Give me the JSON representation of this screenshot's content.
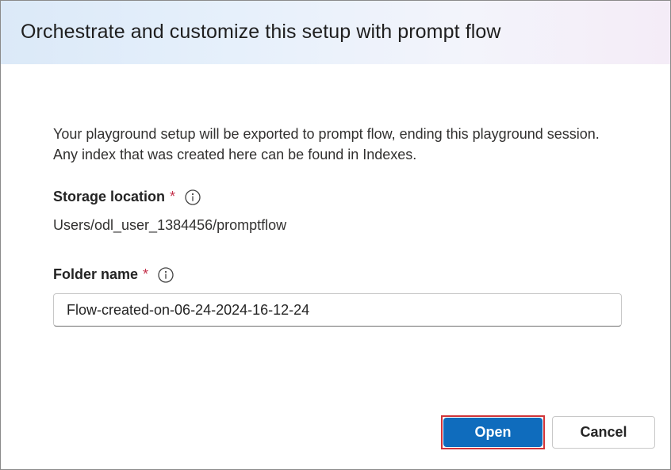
{
  "dialog": {
    "title": "Orchestrate and customize this setup with prompt flow",
    "description": "Your playground setup will be exported to prompt flow, ending this playground session. Any index that was created here can be found in Indexes.",
    "storage": {
      "label": "Storage location",
      "required_mark": "*",
      "info_icon": "info-circle-icon",
      "value": "Users/odl_user_1384456/promptflow"
    },
    "folder": {
      "label": "Folder name",
      "required_mark": "*",
      "info_icon": "info-circle-icon",
      "value": "Flow-created-on-06-24-2024-16-12-24"
    },
    "buttons": {
      "open_label": "Open",
      "cancel_label": "Cancel"
    },
    "colors": {
      "primary": "#0f6cbd",
      "required": "#c4314b",
      "highlight_outline": "#d13438"
    }
  }
}
